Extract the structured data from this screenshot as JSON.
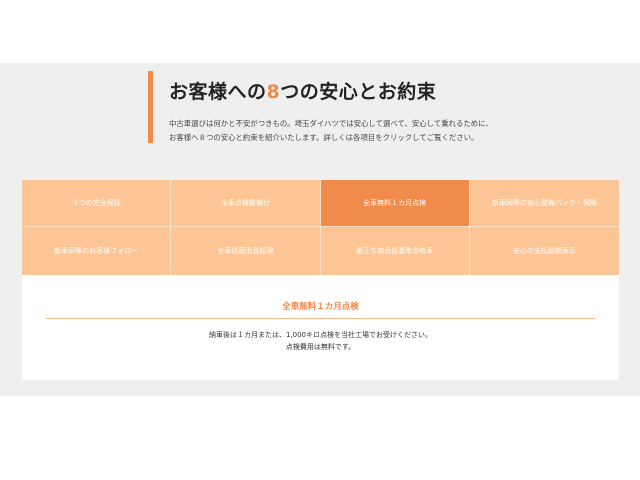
{
  "section": {
    "title_prefix": "お客様への",
    "title_number": "8",
    "title_suffix": "つの安心とお約束",
    "lead_line1": "中古車選びは何かと不安がつきもの。埼玉ダイハツでは安心して選べて、安心して乗れるために、",
    "lead_line2": "お客様へ８つの安心と約束を紹介いたします。詳しくは各項目をクリックしてご覧ください。",
    "accent_color": "#f08b4b"
  },
  "tabs": [
    {
      "label": "３つの完全保証"
    },
    {
      "label": "全車点検整備付"
    },
    {
      "label": "全車無料１カ月点検"
    },
    {
      "label": "新車同等の安心整備パック・保険"
    },
    {
      "label": "新車同等のお客様フォロー"
    },
    {
      "label": "全車抗菌消臭処理"
    },
    {
      "label": "厳正な商品化基準合格車"
    },
    {
      "label": "安心の支払総額表示"
    }
  ],
  "active_tab_index": 2,
  "content": {
    "title": "全車無料１カ月点検",
    "line1": "納車後は１カ月または、1,000キロ点検を当社工場でお受けください。",
    "line2": "点検費用は無料です。"
  }
}
